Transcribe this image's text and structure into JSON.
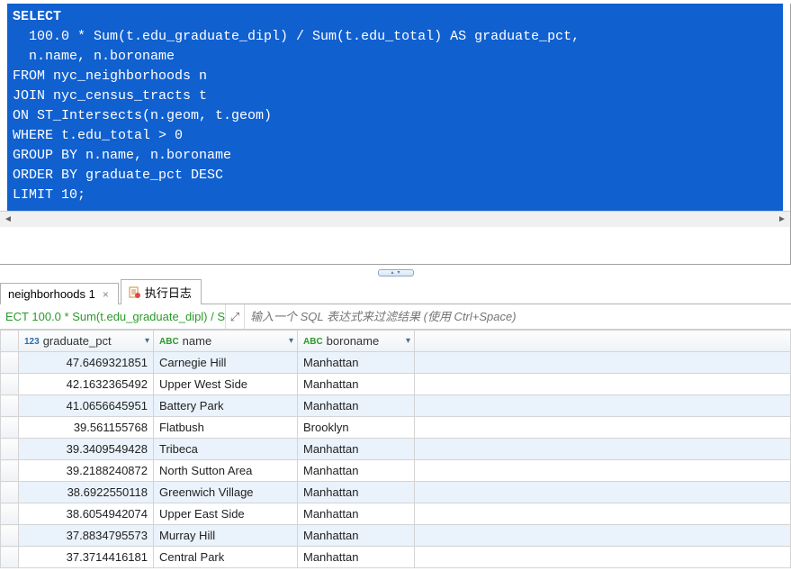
{
  "sql": {
    "l1": "SELECT",
    "l2": "  100.0 * Sum(t.edu_graduate_dipl) / Sum(t.edu_total) AS graduate_pct,",
    "l3": "  n.name, n.boroname",
    "l4": "FROM nyc_neighborhoods n",
    "l5": "JOIN nyc_census_tracts t",
    "l6": "ON ST_Intersects(n.geom, t.geom)",
    "l7": "WHERE t.edu_total > 0",
    "l8": "GROUP BY n.name, n.boroname",
    "l9": "ORDER BY graduate_pct DESC",
    "l10": "LIMIT 10;"
  },
  "tabs": {
    "result_label": "neighborhoods 1",
    "log_label": "执行日志"
  },
  "filter": {
    "summary": "ECT 100.0 * Sum(t.edu_graduate_dipl) / S",
    "placeholder": "输入一个 SQL 表达式来过滤结果 (使用 Ctrl+Space)"
  },
  "columns": {
    "c0": "graduate_pct",
    "c1": "name",
    "c2": "boroname"
  },
  "icons": {
    "num": "123",
    "txt": "ABC",
    "drop": "▾",
    "expand": "⤢",
    "close": "×",
    "left": "◄",
    "right": "►",
    "up": "▴",
    "down": "▾"
  },
  "rows": [
    {
      "pct": "47.6469321851",
      "name": "Carnegie Hill",
      "boro": "Manhattan"
    },
    {
      "pct": "42.1632365492",
      "name": "Upper West Side",
      "boro": "Manhattan"
    },
    {
      "pct": "41.0656645951",
      "name": "Battery Park",
      "boro": "Manhattan"
    },
    {
      "pct": "39.561155768",
      "name": "Flatbush",
      "boro": "Brooklyn"
    },
    {
      "pct": "39.3409549428",
      "name": "Tribeca",
      "boro": "Manhattan"
    },
    {
      "pct": "39.2188240872",
      "name": "North Sutton Area",
      "boro": "Manhattan"
    },
    {
      "pct": "38.6922550118",
      "name": "Greenwich Village",
      "boro": "Manhattan"
    },
    {
      "pct": "38.6054942074",
      "name": "Upper East Side",
      "boro": "Manhattan"
    },
    {
      "pct": "37.8834795573",
      "name": "Murray Hill",
      "boro": "Manhattan"
    },
    {
      "pct": "37.3714416181",
      "name": "Central Park",
      "boro": "Manhattan"
    }
  ],
  "chart_data": {
    "type": "table",
    "title": "graduate_pct by neighborhood",
    "columns": [
      "graduate_pct",
      "name",
      "boroname"
    ],
    "rows": [
      [
        47.6469321851,
        "Carnegie Hill",
        "Manhattan"
      ],
      [
        42.1632365492,
        "Upper West Side",
        "Manhattan"
      ],
      [
        41.0656645951,
        "Battery Park",
        "Manhattan"
      ],
      [
        39.561155768,
        "Flatbush",
        "Brooklyn"
      ],
      [
        39.3409549428,
        "Tribeca",
        "Manhattan"
      ],
      [
        39.2188240872,
        "North Sutton Area",
        "Manhattan"
      ],
      [
        38.6922550118,
        "Greenwich Village",
        "Manhattan"
      ],
      [
        38.6054942074,
        "Upper East Side",
        "Manhattan"
      ],
      [
        37.8834795573,
        "Murray Hill",
        "Manhattan"
      ],
      [
        37.3714416181,
        "Central Park",
        "Manhattan"
      ]
    ]
  }
}
